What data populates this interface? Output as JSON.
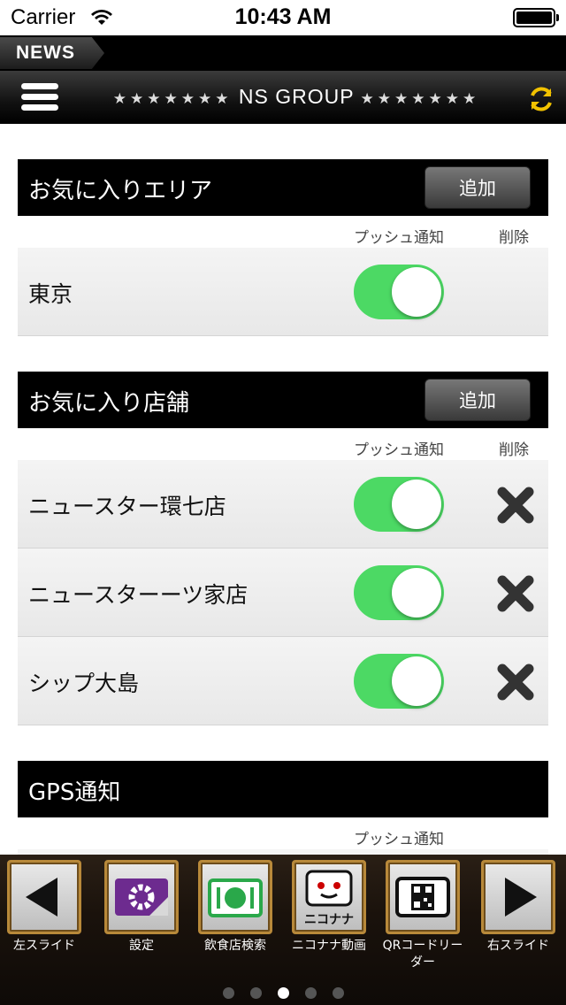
{
  "status_bar": {
    "carrier": "Carrier",
    "time": "10:43 AM"
  },
  "news_tab": {
    "label": "NEWS"
  },
  "header": {
    "stars_left": "★★★★★★★",
    "title": "NS GROUP",
    "stars_right": "★★★★★★★",
    "menu_icon": "hamburger-icon",
    "refresh_icon": "refresh-icon"
  },
  "colors": {
    "toggle_on": "#4cd964",
    "header_bg": "#000000",
    "row_bg": "#ececec"
  },
  "sections": [
    {
      "title": "お気に入りエリア",
      "add_label": "追加",
      "col_push": "プッシュ通知",
      "col_delete": "削除",
      "rows": [
        {
          "name": "東京",
          "push": true,
          "deletable": false
        }
      ]
    },
    {
      "title": "お気に入り店舗",
      "add_label": "追加",
      "col_push": "プッシュ通知",
      "col_delete": "削除",
      "rows": [
        {
          "name": "ニュースター環七店",
          "push": true,
          "deletable": true
        },
        {
          "name": "ニュースターーツ家店",
          "push": true,
          "deletable": true
        },
        {
          "name": "シップ大島",
          "push": true,
          "deletable": true
        }
      ]
    },
    {
      "title": "GPS通知",
      "col_push": "プッシュ通知"
    }
  ],
  "toolbar": [
    {
      "label": "左スライド",
      "icon": "left-arrow-icon"
    },
    {
      "label": "設定",
      "icon": "gear-icon"
    },
    {
      "label": "飲食店検索",
      "icon": "restaurant-icon"
    },
    {
      "label": "ニコナナ動画",
      "icon": "nikonana-tv-icon",
      "logo_text": "ニコナナ"
    },
    {
      "label": "QRコードリーダー",
      "icon": "qr-code-icon"
    },
    {
      "label": "右スライド",
      "icon": "right-arrow-icon"
    }
  ],
  "pager": {
    "pages": 5,
    "active_index": 2
  }
}
